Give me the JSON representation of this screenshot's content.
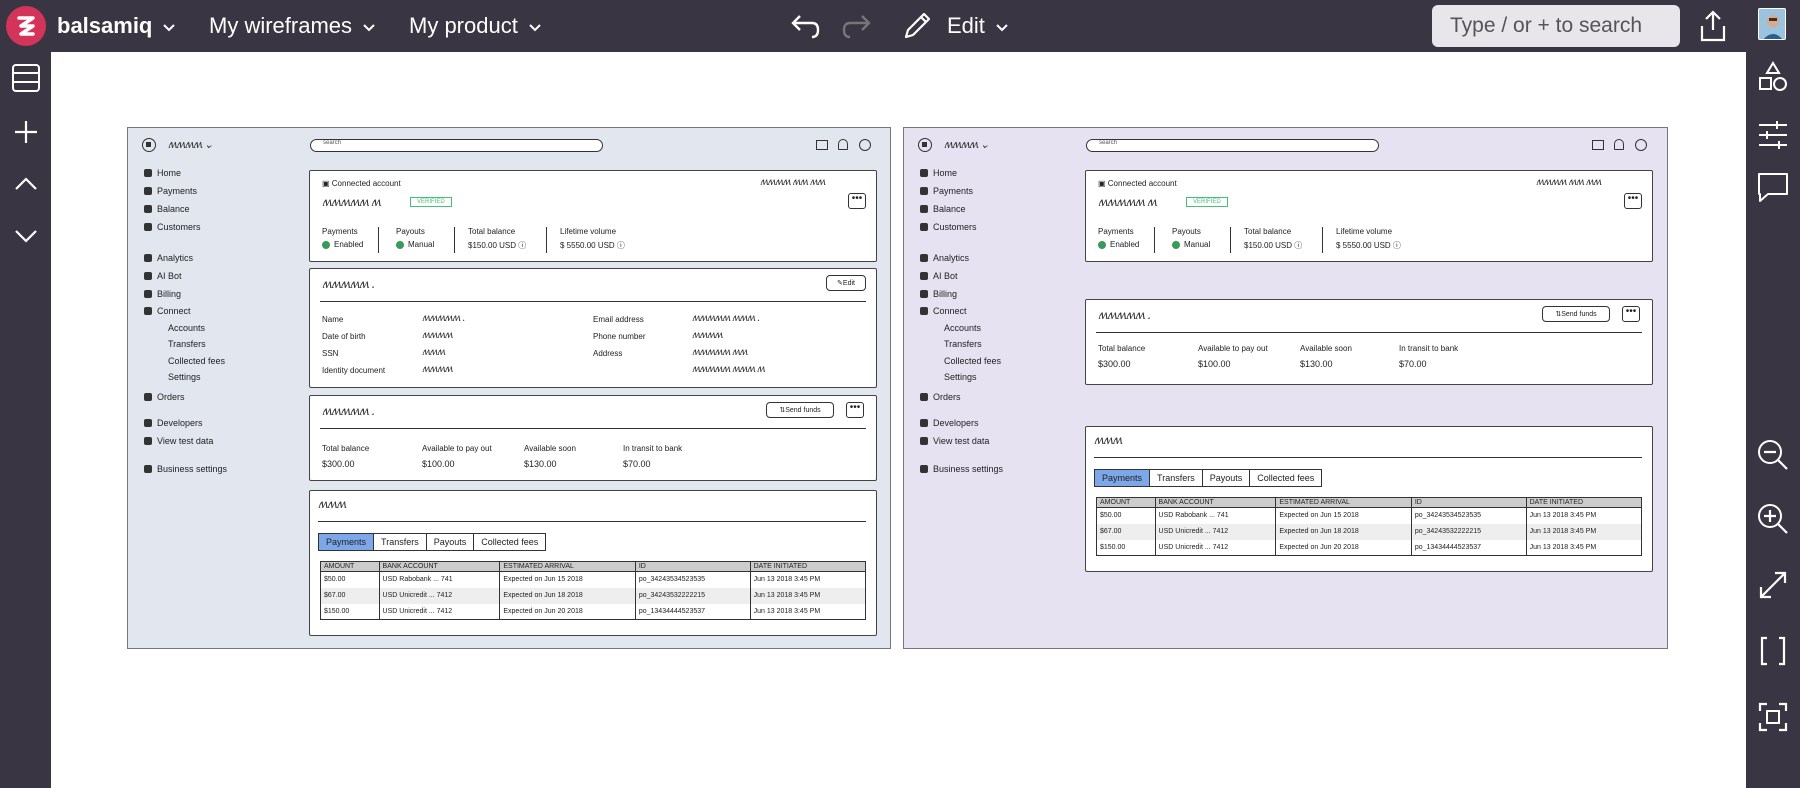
{
  "app": {
    "name": "balsamiq",
    "colors": {
      "bar": "#3a3542",
      "brand": "#d4335a"
    }
  },
  "topbar": {
    "menus": [
      "My wireframes",
      "My product"
    ],
    "edit_label": "Edit",
    "search_placeholder": "Type / or + to search"
  },
  "wireframe": {
    "nav": [
      "Home",
      "Payments",
      "Balance",
      "Customers",
      "Analytics",
      "AI Bot",
      "Billing",
      "Connect",
      "Orders",
      "Developers",
      "View test data",
      "Business settings"
    ],
    "connect_sub": [
      "Accounts",
      "Transfers",
      "Collected fees",
      "Settings"
    ],
    "search_label": "search",
    "connected_account": "Connected account",
    "verified": "VERIFIED",
    "stats": {
      "payments_label": "Payments",
      "payments_value": "Enabled",
      "payouts_label": "Payouts",
      "payouts_value": "Manual",
      "total_balance_label": "Total balance",
      "total_balance_value": "$150.00 USD",
      "lifetime_label": "Lifetime volume",
      "lifetime_value": "$ 5550.00 USD"
    },
    "edit_button": "Edit",
    "fields": [
      "Name",
      "Date of birth",
      "SSN",
      "Identity document",
      "Email address",
      "Phone number",
      "Address"
    ],
    "send_funds": "Send funds",
    "balances": [
      {
        "label": "Total balance",
        "value": "$300.00"
      },
      {
        "label": "Available to pay out",
        "value": "$100.00"
      },
      {
        "label": "Available soon",
        "value": "$130.00"
      },
      {
        "label": "In transit to bank",
        "value": "$70.00"
      }
    ],
    "tabs": [
      "Payments",
      "Transfers",
      "Payouts",
      "Collected fees"
    ],
    "table_headers": [
      "AMOUNT",
      "BANK ACCOUNT",
      "ESTIMATED ARRIVAL",
      "ID",
      "DATE INITIATED"
    ],
    "table_rows": [
      [
        "$50.00",
        "USD Rabobank ... 741",
        "Expected on Jun 15 2018",
        "po_34243534523535",
        "Jun 13 2018 3:45 PM"
      ],
      [
        "$67.00",
        "USD Unicredit ... 7412",
        "Expected on Jun 18 2018",
        "po_34243532222215",
        "Jun 13 2018 3:45 PM"
      ],
      [
        "$150.00",
        "USD Unicredit ... 7412",
        "Expected on Jun 20 2018",
        "po_13434444523537",
        "Jun 13 2018 3:45 PM"
      ]
    ]
  }
}
